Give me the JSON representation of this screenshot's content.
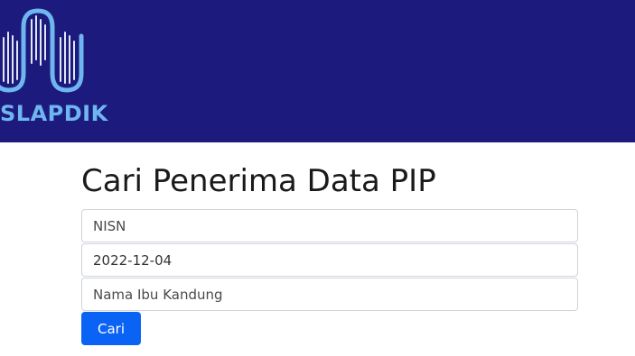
{
  "header": {
    "logo_text": "SLAPDIK",
    "background_color": "#1c1a7c",
    "logo_color": "#6fb6f0"
  },
  "main": {
    "title": "Cari Penerima Data PIP",
    "form": {
      "nisn": {
        "placeholder": "NISN",
        "value": ""
      },
      "date": {
        "placeholder": "",
        "value": "2022-12-04"
      },
      "mother_name": {
        "placeholder": "Nama Ibu Kandung",
        "value": ""
      },
      "submit_label": "Cari",
      "submit_color": "#0b63f5"
    }
  }
}
